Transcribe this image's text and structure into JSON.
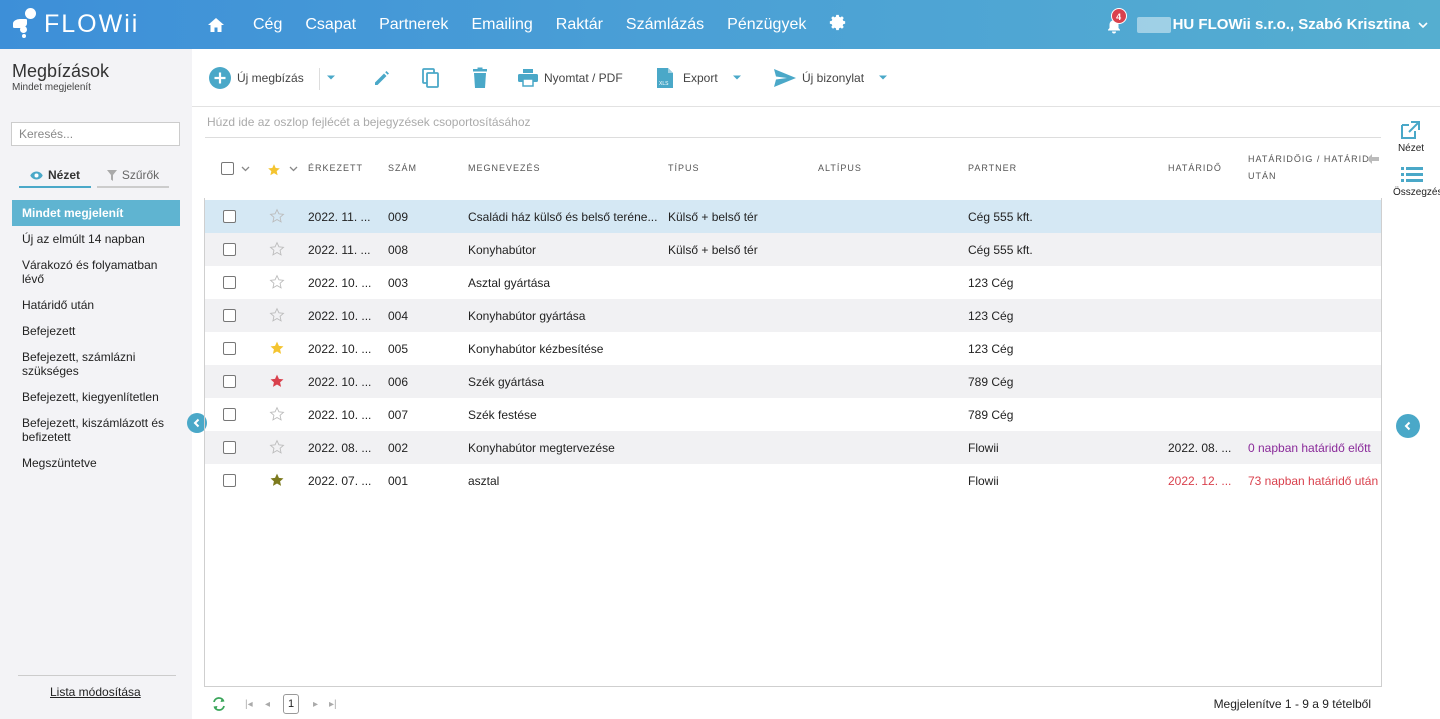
{
  "topbar": {
    "logo_text": "FLOWii",
    "nav": [
      "Cég",
      "Csapat",
      "Partnerek",
      "Emailing",
      "Raktár",
      "Számlázás",
      "Pénzügyek"
    ],
    "notification_count": "4",
    "company_user": "HU FLOWii s.r.o., Szabó Krisztina"
  },
  "left": {
    "title": "Megbízások",
    "subtitle": "Mindet megjelenít",
    "search_placeholder": "Keresés...",
    "tab_view": "Nézet",
    "tab_filters": "Szűrők",
    "views": [
      "Mindet megjelenít",
      "Új az elmúlt 14 napban",
      "Várakozó és folyamatban lévő",
      "Határidő után",
      "Befejezett",
      "Befejezett, számlázni szükséges",
      "Befejezett, kiegyenlítetlen",
      "Befejezett, kiszámlázott és befizetett",
      "Megszüntetve"
    ],
    "list_modify": "Lista módosítása"
  },
  "toolbar": {
    "new_order": "Új megbízás",
    "print": "Nyomtat / PDF",
    "export": "Export",
    "new_document": "Új bizonylat"
  },
  "grid": {
    "group_hint": "Húzd ide az oszlop fejlécét a bejegyzések csoportosításához",
    "headers": {
      "received": "Érkezett",
      "number": "Szám",
      "name": "Megnevezés",
      "type": "Típus",
      "subtype": "Altípus",
      "partner": "Partner",
      "deadline": "Határidő",
      "until_after_1": "Határidőig / határidő",
      "until_after_2": "után"
    },
    "rows": [
      {
        "star": "empty",
        "received": "2022. 11. ...",
        "number": "009",
        "name": "Családi ház külső és belső teréne...",
        "type": "Külső + belső tér",
        "subtype": "",
        "partner": "Cég 555 kft.",
        "deadline": "",
        "until": "",
        "status": "",
        "selected": true
      },
      {
        "star": "empty",
        "received": "2022. 11. ...",
        "number": "008",
        "name": "Konyhabútor",
        "type": "Külső + belső tér",
        "subtype": "",
        "partner": "Cég 555 kft.",
        "deadline": "",
        "until": "",
        "status": ""
      },
      {
        "star": "empty",
        "received": "2022. 10. ...",
        "number": "003",
        "name": "Asztal gyártása",
        "type": "",
        "subtype": "",
        "partner": "123 Cég",
        "deadline": "",
        "until": "",
        "status": ""
      },
      {
        "star": "empty",
        "received": "2022. 10. ...",
        "number": "004",
        "name": "Konyhabútor gyártása",
        "type": "",
        "subtype": "",
        "partner": "123 Cég",
        "deadline": "",
        "until": "",
        "status": ""
      },
      {
        "star": "yellow",
        "received": "2022. 10. ...",
        "number": "005",
        "name": "Konyhabútor kézbesítése",
        "type": "",
        "subtype": "",
        "partner": "123 Cég",
        "deadline": "",
        "until": "",
        "status": ""
      },
      {
        "star": "red",
        "received": "2022. 10. ...",
        "number": "006",
        "name": "Szék gyártása",
        "type": "",
        "subtype": "",
        "partner": "789 Cég",
        "deadline": "",
        "until": "",
        "status": ""
      },
      {
        "star": "empty",
        "received": "2022. 10. ...",
        "number": "007",
        "name": "Szék festése",
        "type": "",
        "subtype": "",
        "partner": "789 Cég",
        "deadline": "",
        "until": "",
        "status": ""
      },
      {
        "star": "empty",
        "received": "2022. 08. ...",
        "number": "002",
        "name": "Konyhabútor megtervezése",
        "type": "",
        "subtype": "",
        "partner": "Flowii",
        "deadline": "2022. 08. ...",
        "until": "0 napban határidő előtt",
        "status": "early"
      },
      {
        "star": "olive",
        "received": "2022. 07. ...",
        "number": "001",
        "name": "asztal",
        "type": "",
        "subtype": "",
        "partner": "Flowii",
        "deadline": "2022. 12. ...",
        "until": "73 napban határidő után",
        "status": "overdue"
      }
    ]
  },
  "rail": {
    "view": "Nézet",
    "summary": "Összegzés"
  },
  "pager": {
    "page": "1",
    "info": "Megjelenítve 1 - 9 a 9 tételből"
  },
  "colors": {
    "accent": "#4aa8c8",
    "selected_view": "#5fb4d1",
    "overdue": "#d9414d",
    "early": "#8a2a9a",
    "star_yellow": "#f4c430",
    "star_red": "#d9414d",
    "star_olive": "#7c7a1e"
  }
}
